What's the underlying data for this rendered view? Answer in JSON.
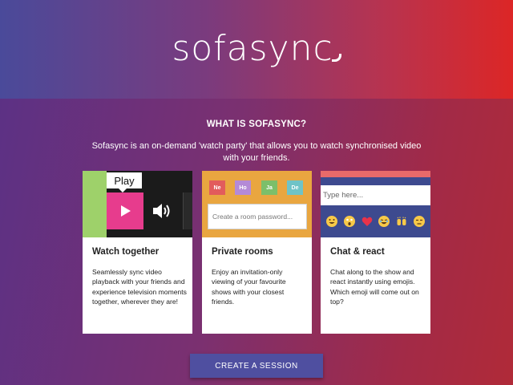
{
  "hero": {
    "logo_text": "sofasync"
  },
  "section": {
    "title": "WHAT IS SOFASYNC?",
    "intro": "Sofasync is an on-demand 'watch party' that allows you to watch synchronised video with your friends."
  },
  "cards": [
    {
      "title": "Watch together",
      "desc": "Seamlessly sync video playback with your friends and experience television moments together, wherever they are!",
      "media": {
        "play_label": "Play",
        "icons": [
          "play-icon",
          "volume-icon"
        ]
      }
    },
    {
      "title": "Private rooms",
      "desc": "Enjoy an invitation-only viewing of your favourite shows with your closest friends.",
      "media": {
        "tags": [
          "Ne",
          "Ho",
          "Ja",
          "De"
        ],
        "tag_colors": [
          "#e25c5c",
          "#b48ad6",
          "#7cbf6a",
          "#6fc3c7"
        ],
        "password_placeholder": "Create a room password..."
      }
    },
    {
      "title": "Chat & react",
      "desc": "Chat along to the show and react instantly using emojis. Which emoji will come out on top?",
      "media": {
        "input_placeholder": "Type here...",
        "emojis": [
          "grinning-emoji",
          "astonished-emoji",
          "heart-emoji",
          "laughing-emoji",
          "raised-hands-emoji",
          "unamused-emoji"
        ]
      }
    }
  ],
  "cta": {
    "label": "CREATE A SESSION"
  },
  "colors": {
    "accent_pink": "#e73c8d",
    "button": "#4f4fa0",
    "card_green": "#9ed16a",
    "card_orange": "#e9a640",
    "chat_blue": "#3d4a8f"
  }
}
